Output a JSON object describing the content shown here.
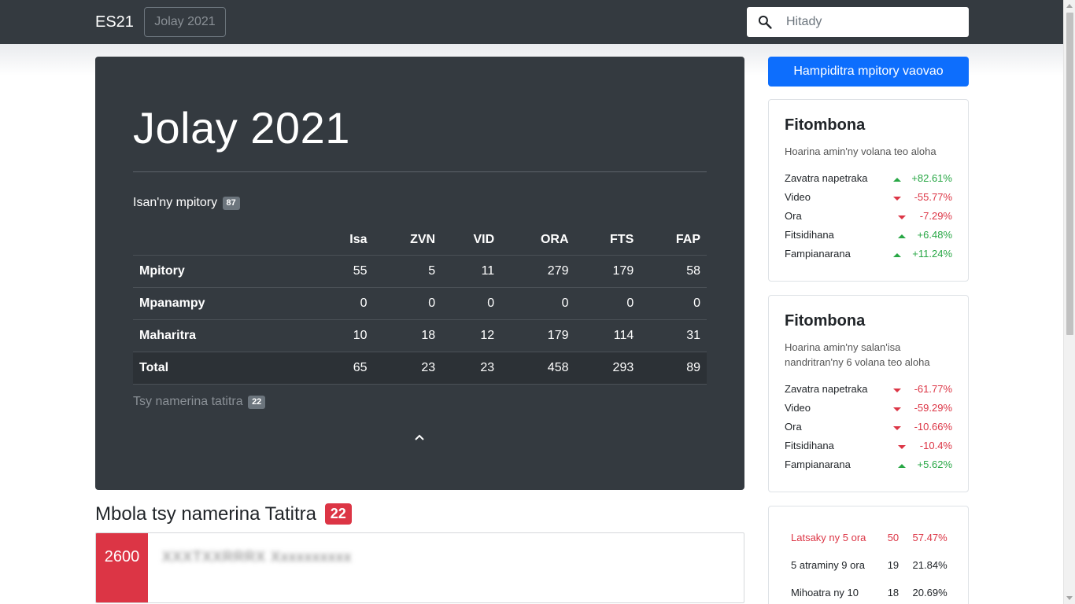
{
  "nav": {
    "brand": "ES21",
    "month_button": "Jolay 2021",
    "search_placeholder": "Hitady"
  },
  "jumbotron": {
    "title": "Jolay 2021",
    "total_label": "Isan'ny mpitory",
    "total_count": "87",
    "table": {
      "columns": [
        "Isa",
        "ZVN",
        "VID",
        "ORA",
        "FTS",
        "FAP"
      ],
      "rows": [
        {
          "label": "Mpitory",
          "values": [
            "55",
            "5",
            "11",
            "279",
            "179",
            "58"
          ]
        },
        {
          "label": "Mpanampy",
          "values": [
            "0",
            "0",
            "0",
            "0",
            "0",
            "0"
          ]
        },
        {
          "label": "Maharitra",
          "values": [
            "10",
            "18",
            "12",
            "179",
            "114",
            "31"
          ]
        },
        {
          "label": "Total",
          "values": [
            "65",
            "23",
            "23",
            "458",
            "293",
            "89"
          ]
        }
      ]
    },
    "missing_label": "Tsy namerina tatitra",
    "missing_count": "22"
  },
  "missing_section": {
    "title": "Mbola tsy namerina Tatitra",
    "count": "22",
    "ticket": {
      "number": "2600",
      "blurred_text": "XXXTXXRRRX Xxxxxxxxxx"
    }
  },
  "sidebar": {
    "new_button": "Hampiditra mpitory vaovao",
    "card1": {
      "title": "Fitombona",
      "subtitle": "Hoarina amin'ny volana teo aloha",
      "items": [
        {
          "label": "Zavatra napetraka",
          "value": "+82.61%",
          "dir": "up"
        },
        {
          "label": "Video",
          "value": "-55.77%",
          "dir": "down"
        },
        {
          "label": "Ora",
          "value": "-7.29%",
          "dir": "down"
        },
        {
          "label": "Fitsidihana",
          "value": "+6.48%",
          "dir": "up"
        },
        {
          "label": "Fampianarana",
          "value": "+11.24%",
          "dir": "up"
        }
      ]
    },
    "card2": {
      "title": "Fitombona",
      "subtitle": "Hoarina amin'ny salan'isa nandritran'ny 6 volana teo aloha",
      "items": [
        {
          "label": "Zavatra napetraka",
          "value": "-61.77%",
          "dir": "down"
        },
        {
          "label": "Video",
          "value": "-59.29%",
          "dir": "down"
        },
        {
          "label": "Ora",
          "value": "-10.66%",
          "dir": "down"
        },
        {
          "label": "Fitsidihana",
          "value": "-10.4%",
          "dir": "down"
        },
        {
          "label": "Fampianarana",
          "value": "+5.62%",
          "dir": "up"
        }
      ]
    },
    "hours_card": {
      "rows": [
        {
          "label": "Latsaky ny 5 ora",
          "count": "50",
          "percent": "57.47%",
          "highlight": true
        },
        {
          "label": "5 atraminy 9 ora",
          "count": "19",
          "percent": "21.84%",
          "highlight": false
        },
        {
          "label": "Mihoatra ny 10",
          "count": "18",
          "percent": "20.69%",
          "highlight": false
        }
      ]
    }
  },
  "colors": {
    "dark": "#343a40",
    "primary": "#0d6efd",
    "danger": "#dc3545",
    "success": "#28a745"
  }
}
